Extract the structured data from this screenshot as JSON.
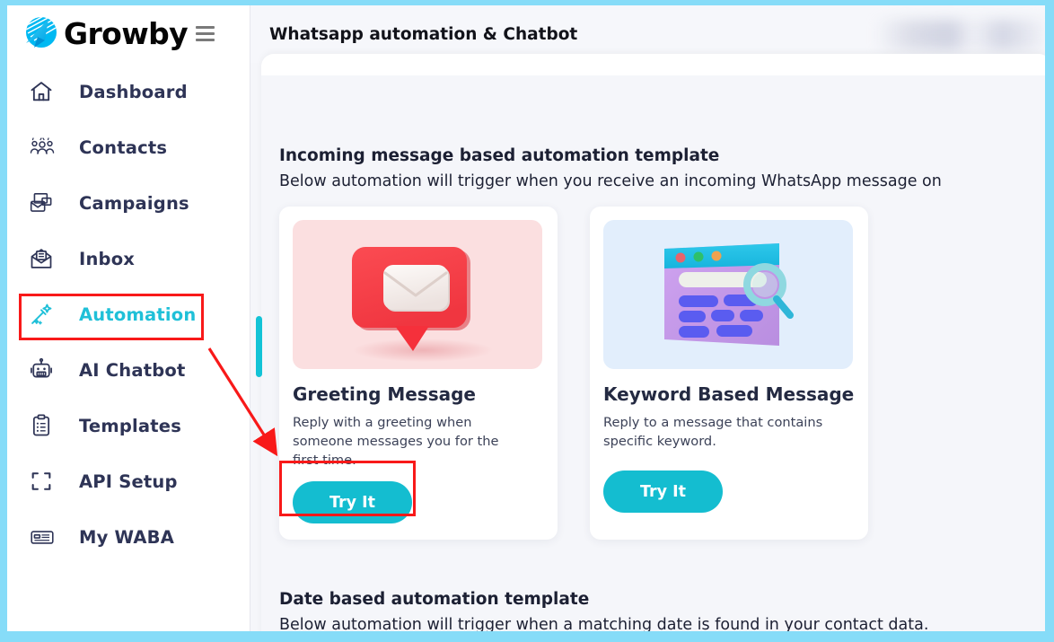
{
  "brand": {
    "name": "Growby",
    "logo_icon": "paper-plane-circle-logo",
    "menu_icon": "hamburger-menu-icon"
  },
  "sidebar": {
    "items": [
      {
        "label": "Dashboard",
        "icon": "home-icon",
        "active": false
      },
      {
        "label": "Contacts",
        "icon": "people-icon",
        "active": false
      },
      {
        "label": "Campaigns",
        "icon": "mail-stack-icon",
        "active": false
      },
      {
        "label": "Inbox",
        "icon": "inbox-icon",
        "active": false
      },
      {
        "label": "Automation",
        "icon": "magic-wand-icon",
        "active": true
      },
      {
        "label": "AI Chatbot",
        "icon": "robot-icon",
        "active": false
      },
      {
        "label": "Templates",
        "icon": "clipboard-icon",
        "active": false
      },
      {
        "label": "API Setup",
        "icon": "brackets-icon",
        "active": false
      },
      {
        "label": "My WABA",
        "icon": "id-card-icon",
        "active": false
      }
    ]
  },
  "header": {
    "title": "Whatsapp automation & Chatbot"
  },
  "main": {
    "incoming_section": {
      "title": "Incoming message based automation template",
      "subtitle": "Below automation will trigger when you receive an incoming WhatsApp message on"
    },
    "cards": [
      {
        "title": "Greeting Message",
        "description": "Reply with a greeting when someone messages you for the first time.",
        "button_label": "Try It",
        "thumb_icon": "red-chat-bubble-envelope-illustration"
      },
      {
        "title": "Keyword Based Message",
        "description": "Reply to a message that contains specific keyword.",
        "button_label": "Try It",
        "thumb_icon": "purple-browser-window-search-illustration"
      }
    ],
    "date_section": {
      "title": "Date based automation template",
      "subtitle": "Below automation will trigger when a matching date is found in your contact data."
    }
  },
  "colors": {
    "accent_teal": "#14bdd0",
    "brand_blue": "#00b9f2",
    "annotation_red": "#f81919",
    "text_dark": "#2e3456",
    "page_bg": "#f5f6fa",
    "frame_blue": "#86dcf8"
  },
  "annotations": {
    "highlight_sidebar_item": "Automation",
    "highlight_button": "Try It",
    "arrow": "red-arrow-from-automation-to-try-it"
  }
}
